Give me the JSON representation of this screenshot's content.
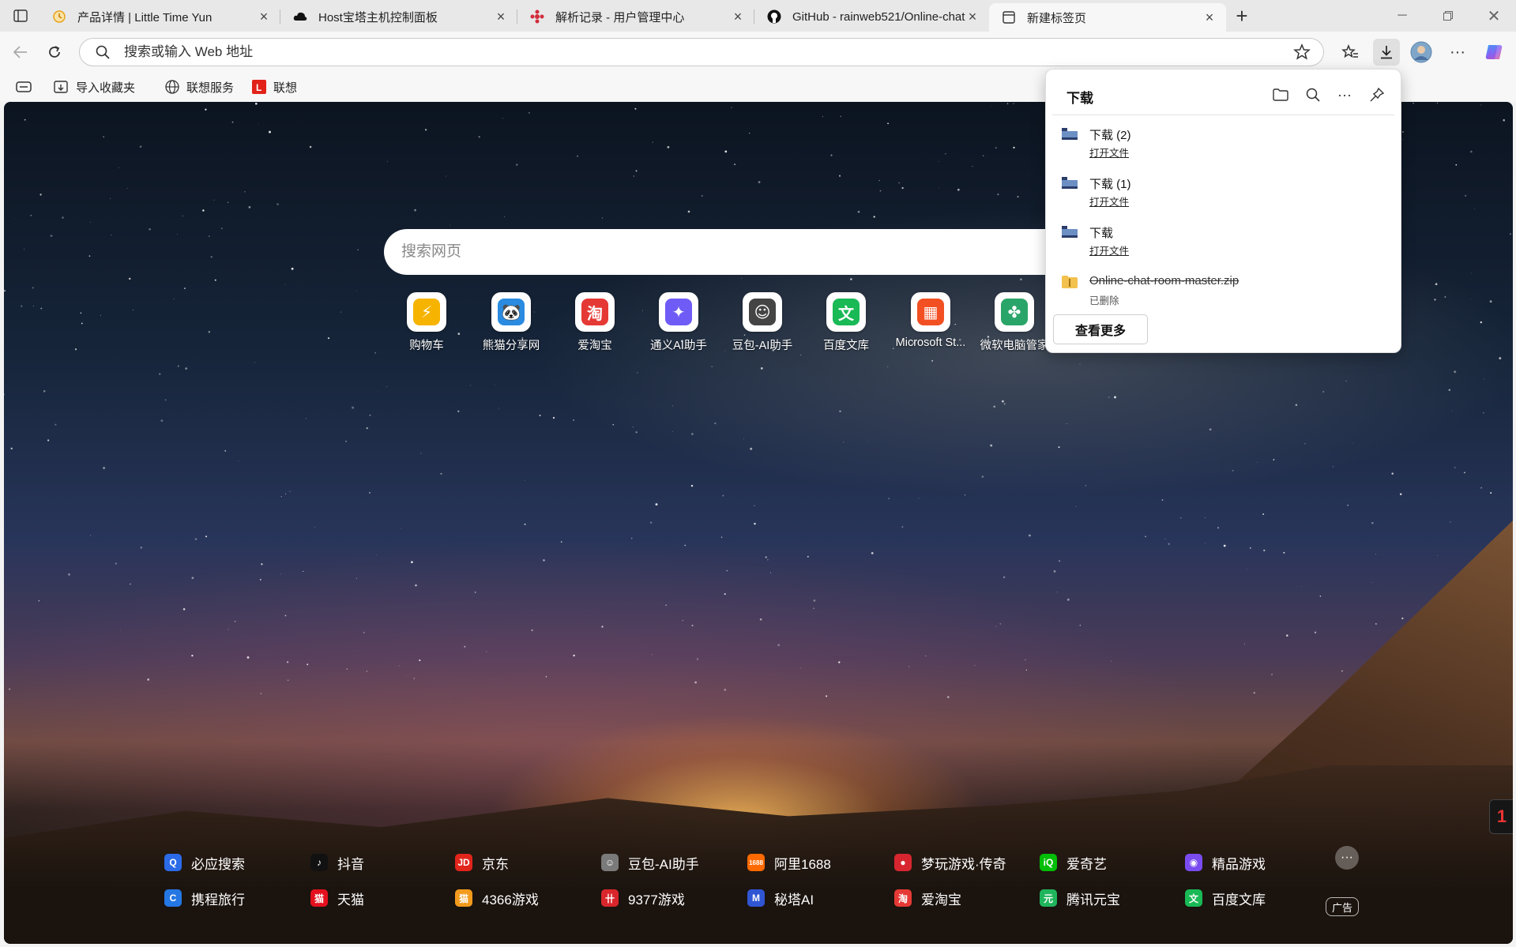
{
  "tabs": [
    {
      "title": "产品详情 | Little Time Yun",
      "favicon": "clock-orange-icon"
    },
    {
      "title": "Host宝塔主机控制面板",
      "favicon": "cloud-icon"
    },
    {
      "title": "解析记录 - 用户管理中心",
      "favicon": "dns-red-icon"
    },
    {
      "title": "GitHub - rainweb521/Online-chat",
      "favicon": "github-icon"
    },
    {
      "title": "新建标签页",
      "favicon": "newtab-icon",
      "active": true
    }
  ],
  "toolbar": {
    "address_placeholder": "搜索或输入 Web 地址"
  },
  "favorites_bar": [
    {
      "label": "导入收藏夹",
      "icon": "import-favorites-icon"
    },
    {
      "label": "联想服务",
      "icon": "globe-icon"
    },
    {
      "label": "联想",
      "icon": "lenovo-logo-icon"
    }
  ],
  "page": {
    "search_placeholder": "搜索网页",
    "quick_links": [
      {
        "label": "购物车",
        "icon": "shopping-cart-icon",
        "color": "#f6b400"
      },
      {
        "label": "熊猫分享网",
        "icon": "panda-icon",
        "color": "#2a8be0"
      },
      {
        "label": "爱淘宝",
        "icon": "taobao-icon",
        "color": "#e53935"
      },
      {
        "label": "通义AI助手",
        "icon": "tongyi-icon",
        "color": "#6f5cf6"
      },
      {
        "label": "豆包-AI助手",
        "icon": "doubao-icon",
        "color": "#444444"
      },
      {
        "label": "百度文库",
        "icon": "wenku-icon",
        "color": "#19b955"
      },
      {
        "label": "Microsoft St...",
        "icon": "microsoft-store-icon",
        "color": "#f25022"
      },
      {
        "label": "微软电脑管家",
        "icon": "pc-manager-icon",
        "color": "#2aa56a"
      }
    ],
    "bottom_links": [
      {
        "label": "必应搜索",
        "icon": "bing-search-icon",
        "color": "#2b6be8"
      },
      {
        "label": "抖音",
        "icon": "douyin-icon",
        "color": "#111111"
      },
      {
        "label": "京东",
        "icon": "jd-icon",
        "color": "#e1251b"
      },
      {
        "label": "豆包-AI助手",
        "icon": "doubao-icon",
        "color": "#7a7a7a"
      },
      {
        "label": "阿里1688",
        "icon": "ali1688-icon",
        "color": "#ff6a00"
      },
      {
        "label": "梦玩游戏·传奇",
        "icon": "game-ball-icon",
        "color": "#d7262f"
      },
      {
        "label": "爱奇艺",
        "icon": "iqiyi-icon",
        "color": "#00be06"
      },
      {
        "label": "精品游戏",
        "icon": "gamepad-icon",
        "color": "#7a4cf0"
      },
      {
        "label": "携程旅行",
        "icon": "ctrip-icon",
        "color": "#2577e3"
      },
      {
        "label": "天猫",
        "icon": "tmall-icon",
        "color": "#e3101e"
      },
      {
        "label": "4366游戏",
        "icon": "cat-game-icon",
        "color": "#f39a1d"
      },
      {
        "label": "9377游戏",
        "icon": "9377-icon",
        "color": "#d9262c"
      },
      {
        "label": "秘塔AI",
        "icon": "metaso-icon",
        "color": "#3056d3"
      },
      {
        "label": "爱淘宝",
        "icon": "taobao-icon",
        "color": "#e53935"
      },
      {
        "label": "腾讯元宝",
        "icon": "yuanbao-icon",
        "color": "#1fb55c"
      },
      {
        "label": "百度文库",
        "icon": "wenku-icon",
        "color": "#19b955"
      }
    ],
    "ad_label": "广告"
  },
  "downloads": {
    "title": "下载",
    "items": [
      {
        "name": "下载 (2)",
        "sub": "打开文件",
        "deleted": false
      },
      {
        "name": "下载 (1)",
        "sub": "打开文件",
        "deleted": false
      },
      {
        "name": "下载",
        "sub": "打开文件",
        "deleted": false
      },
      {
        "name": "Online-chat-room-master.zip",
        "sub": "已删除",
        "deleted": true
      }
    ],
    "see_more": "查看更多"
  }
}
